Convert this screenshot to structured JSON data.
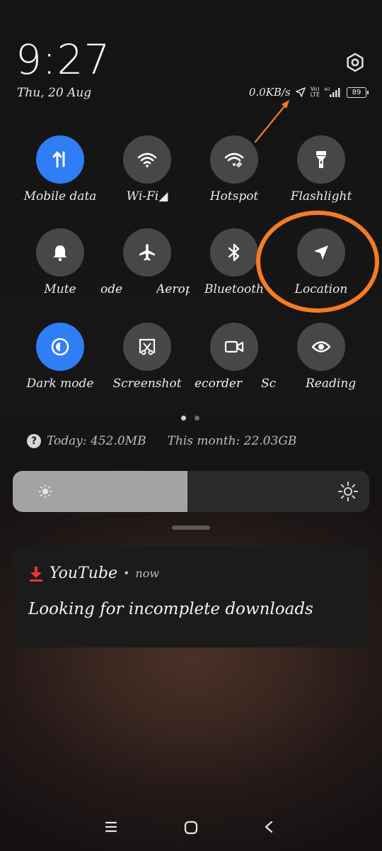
{
  "status": {
    "time": "9:27",
    "date": "Thu, 20 Aug",
    "network_speed": "0.0KB/s",
    "volte_label_top": "Vo)",
    "volte_label_bottom": "LTE",
    "battery": "89"
  },
  "tiles": [
    {
      "label": "Mobile data",
      "icon": "mobile-data-icon",
      "active": true
    },
    {
      "label": "Wi-Fi◢",
      "icon": "wifi-icon",
      "active": false
    },
    {
      "label": "Hotspot",
      "icon": "hotspot-icon",
      "active": false
    },
    {
      "label": "Flashlight",
      "icon": "flashlight-icon",
      "active": false
    },
    {
      "label": "Mute",
      "icon": "bell-icon",
      "active": false
    },
    {
      "label": "ode",
      "icon": "airplane-icon",
      "active": false
    },
    {
      "label": "Aerop",
      "icon": "airplane-icon",
      "active": false
    },
    {
      "label": "Bluetooth",
      "icon": "bluetooth-icon",
      "active": false
    },
    {
      "label": "Location",
      "icon": "location-icon",
      "active": false
    },
    {
      "label": "Dark mode",
      "icon": "dark-mode-icon",
      "active": true
    },
    {
      "label": "Screenshot",
      "icon": "screenshot-icon",
      "active": false
    },
    {
      "label": "ecorder",
      "icon": "screen-recorder-icon",
      "active": false
    },
    {
      "label": "Sc",
      "icon": "",
      "active": false
    },
    {
      "label": "Reading",
      "icon": "eye-icon",
      "active": false
    }
  ],
  "data_usage": {
    "today": "Today: 452.0MB",
    "month": "This month: 22.03GB"
  },
  "brightness": {
    "level": 0.49
  },
  "notification": {
    "app": "YouTube",
    "separator": "•",
    "time": "now",
    "text": "Looking for incomplete downloads"
  },
  "colors": {
    "accent": "#2f7ef6",
    "annotation": "#f57c22",
    "tile_off": "#474747",
    "download_icon": "#e53935"
  }
}
